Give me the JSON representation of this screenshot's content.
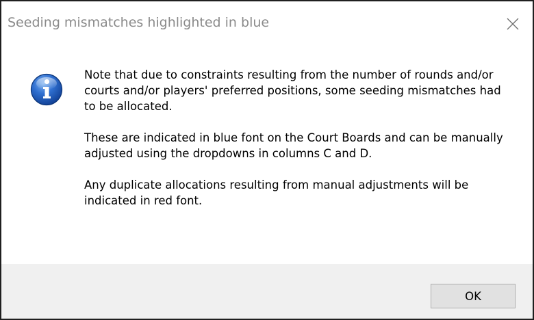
{
  "dialog": {
    "title": "Seeding mismatches highlighted in blue",
    "close_icon": "close-icon",
    "icon": "information-icon",
    "message": {
      "paragraph1": "Note that due to constraints resulting from the number of rounds and/or courts and/or players' preferred positions, some seeding mismatches had to be allocated.",
      "paragraph2": "These are indicated in blue font on the Court Boards and can be manually adjusted using the dropdowns in columns C and D.",
      "paragraph3": "Any duplicate allocations resulting from manual adjustments will be indicated in red font."
    },
    "ok_label": "OK"
  },
  "colors": {
    "title_text": "#8a8a8a",
    "icon_blue": "#1f5fbf",
    "footer_bg": "#f0f0f0",
    "button_bg": "#e1e1e1",
    "button_border": "#adadad"
  }
}
